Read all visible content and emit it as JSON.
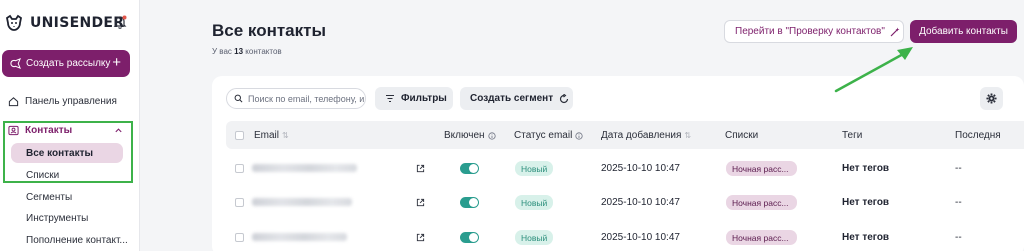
{
  "app": {
    "logo_text": "UNISENDER"
  },
  "sidebar": {
    "create_label": "Создать рассылку",
    "create_plus": "+",
    "dashboard_label": "Панель управления",
    "contacts_label": "Контакты",
    "sub_items": [
      {
        "label": "Все контакты"
      },
      {
        "label": "Списки"
      },
      {
        "label": "Сегменты"
      },
      {
        "label": "Инструменты"
      },
      {
        "label": "Пополнение контакт..."
      }
    ]
  },
  "header": {
    "title": "Все контакты",
    "subtitle_prefix": "У вас",
    "subtitle_count": "13",
    "subtitle_suffix": "контактов",
    "check_button": "Перейти в \"Проверку контактов\"",
    "add_button": "Добавить контакты"
  },
  "toolbar": {
    "search_placeholder": "Поиск по email, телефону, и",
    "filters_label": "Фильтры",
    "segment_label": "Создать сегмент"
  },
  "table": {
    "columns": [
      "Email",
      "Включен",
      "Статус email",
      "Дата добавления",
      "Списки",
      "Теги",
      "Последня"
    ],
    "rows": [
      {
        "enabled": true,
        "status": "Новый",
        "date": "2025-10-10 10:47",
        "list": "Ночная расс...",
        "tags": "Нет тегов",
        "last": "--"
      },
      {
        "enabled": true,
        "status": "Новый",
        "date": "2025-10-10 10:47",
        "list": "Ночная расс...",
        "tags": "Нет тегов",
        "last": "--"
      },
      {
        "enabled": true,
        "status": "Новый",
        "date": "2025-10-10 10:47",
        "list": "Ночная расс...",
        "tags": "Нет тегов",
        "last": "--"
      }
    ]
  },
  "colors": {
    "brand": "#7d1f6b",
    "toggle_on": "#2a9d8f",
    "annotation": "#3db24a"
  }
}
